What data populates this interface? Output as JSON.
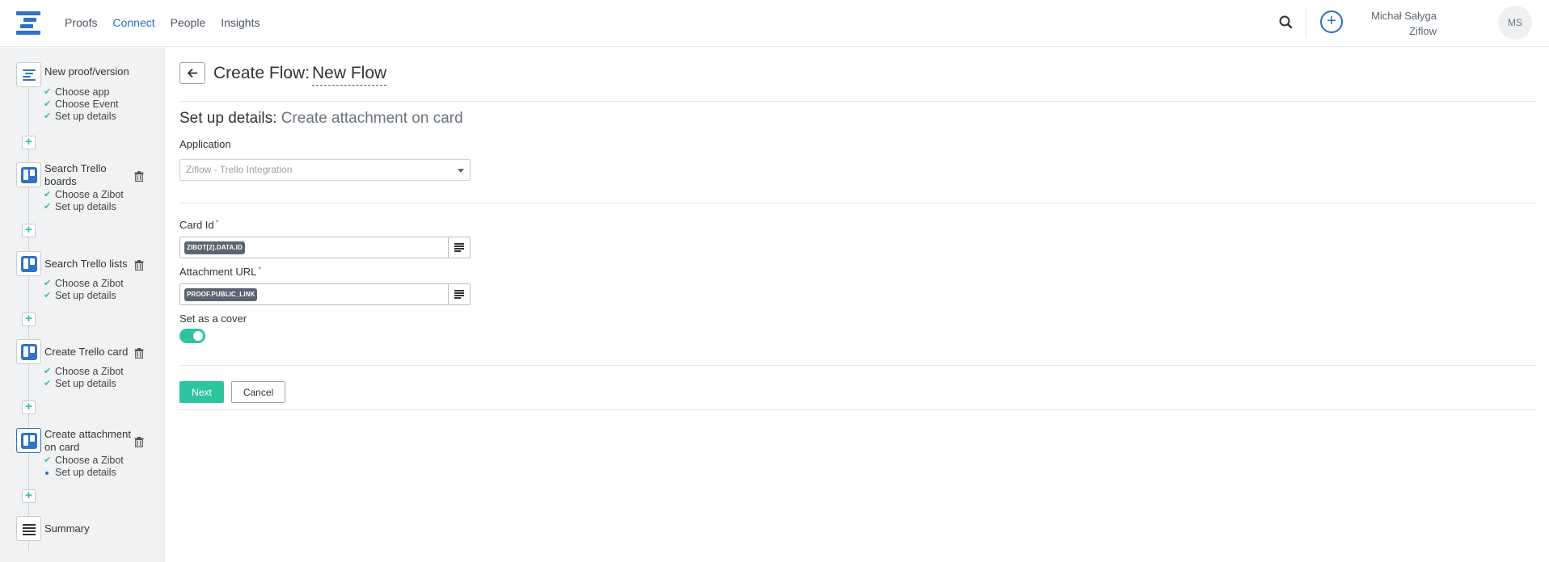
{
  "nav": {
    "items": [
      {
        "label": "Proofs",
        "active": false
      },
      {
        "label": "Connect",
        "active": true
      },
      {
        "label": "People",
        "active": false
      },
      {
        "label": "Insights",
        "active": false
      }
    ],
    "search_icon": "search-icon",
    "add_icon": "plus-circle-icon",
    "add_label": "+"
  },
  "user": {
    "name": "Michał Sałyga",
    "org": "Ziflow",
    "initials": "MS"
  },
  "sidebar": {
    "steps": [
      {
        "title": "New proof/version",
        "icon": "ziflow-icon",
        "substeps": [
          {
            "label": "Choose app",
            "state": "done"
          },
          {
            "label": "Choose Event",
            "state": "done"
          },
          {
            "label": "Set up details",
            "state": "done"
          }
        ]
      },
      {
        "title": "Search Trello boards",
        "icon": "trello-icon",
        "substeps": [
          {
            "label": "Choose a Zibot",
            "state": "done"
          },
          {
            "label": "Set up details",
            "state": "done"
          }
        ]
      },
      {
        "title": "Search Trello lists",
        "icon": "trello-icon",
        "substeps": [
          {
            "label": "Choose a Zibot",
            "state": "done"
          },
          {
            "label": "Set up details",
            "state": "done"
          }
        ]
      },
      {
        "title": "Create Trello card",
        "icon": "trello-icon",
        "substeps": [
          {
            "label": "Choose a Zibot",
            "state": "done"
          },
          {
            "label": "Set up details",
            "state": "done"
          }
        ]
      },
      {
        "title": "Create attachment on card",
        "icon": "trello-icon",
        "substeps": [
          {
            "label": "Choose a Zibot",
            "state": "done"
          },
          {
            "label": "Set up details",
            "state": "current"
          }
        ]
      },
      {
        "title": "Summary",
        "icon": "list-icon",
        "substeps": []
      }
    ],
    "add_step_label": "+"
  },
  "header": {
    "back_icon": "arrow-left-icon",
    "title": "Create Flow:",
    "flow_name": "New Flow"
  },
  "form": {
    "section_title": "Set up details:",
    "section_subtitle": "Create attachment on card",
    "application": {
      "label": "Application",
      "value": "Ziflow - Trello Integration"
    },
    "card_id": {
      "label": "Card Id",
      "required": "*",
      "token": "ZIBOT[2].DATA.ID"
    },
    "attachment_url": {
      "label": "Attachment URL",
      "required": "*",
      "token": "PROOF.PUBLIC_LINK"
    },
    "set_as_cover": {
      "label": "Set as a cover",
      "enabled": true
    },
    "next_label": "Next",
    "cancel_label": "Cancel"
  },
  "colors": {
    "brand_blue": "#2a6fc6",
    "accent_green": "#2ec4a0",
    "token_bg": "#5b6571"
  }
}
